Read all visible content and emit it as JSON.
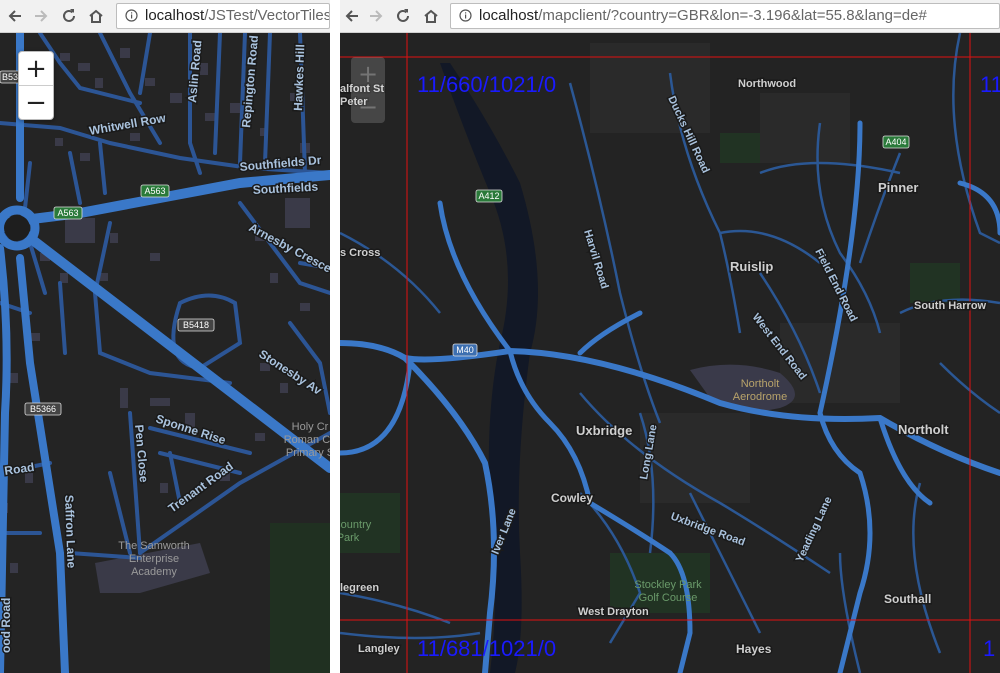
{
  "left_window": {
    "url_host": "localhost",
    "url_path": "/JSTest/VectorTiles/",
    "zoom_in_label": "+",
    "zoom_out_label": "−",
    "labels": {
      "aslin_road": "Aslin Road",
      "repington_road": "Repington Road",
      "hawkes_hill": "Hawkes Hill",
      "whitwell_row": "Whitwell Row",
      "southfields_dr": "Southfields Dr",
      "southfields": "Southfields",
      "arnesby_cresc": "Arnesby Cresce",
      "stonesby_ave": "Stonesby Av",
      "sponne_rise": "Sponne Rise",
      "pen_close": "Pen Close",
      "trenant_road": "Trenant Road",
      "holy_cross_1": "Holy Cr",
      "holy_cross_2": "Roman Ca",
      "holy_cross_3": "Primary S",
      "samworth_1": "The Samworth",
      "samworth_2": "Enterprise",
      "samworth_3": "Academy",
      "saffron_lane": "Saffron Lane",
      "road_left": "Road",
      "ood_road": "ood Road"
    },
    "shields": {
      "a563_1": "A563",
      "a563_2": "A563",
      "b5418": "B5418",
      "b5366": "B5366",
      "b53": "B53"
    }
  },
  "right_window": {
    "url_host": "localhost",
    "url_path": "/mapclient/?country=GBR&lon=-3.196&lat=55.8&lang=de#",
    "zoom_in_label": "+",
    "zoom_out_label": "−",
    "tile_labels": {
      "top_left": "11/660/1021/0",
      "bottom_left": "11/681/1021/0",
      "top_right": "11",
      "bottom_right": "1"
    },
    "labels": {
      "alfont_st": "alfont St",
      "peter": "Peter",
      "northwood": "Northwood",
      "ducks_hill_road": "Ducks Hill Road",
      "pinner": "Pinner",
      "s_cross": "s Cross",
      "harvil_road": "Harvil Road",
      "ruislip": "Ruislip",
      "field_end_road": "Field End Road",
      "south_harrow": "South Harrow",
      "west_end_road": "West End Road",
      "northolt_aerodrome_1": "Northolt",
      "northolt_aerodrome_2": "Aerodrome",
      "uxbridge": "Uxbridge",
      "long_lane": "Long Lane",
      "northolt": "Northolt",
      "cowley": "Cowley",
      "country_1": "Country",
      "country_2": "Park",
      "iver_lane": "Iver Lane",
      "uxbridge_road": "Uxbridge Road",
      "yeading_lane": "Yeading Lane",
      "legreen": "legreen",
      "stockley_1": "Stockley Park",
      "stockley_2": "Golf Course",
      "west_drayton": "West Drayton",
      "southall": "Southall",
      "langley": "Langley",
      "hayes": "Hayes"
    },
    "shields": {
      "a412": "A412",
      "a404": "A404",
      "m40": "M40"
    }
  },
  "colors": {
    "map_bg": "#242424",
    "road_major": "#3a78c8",
    "road_minor": "#2c5595",
    "label_text": "#cfcfcf",
    "tile_label": "#1a1aff",
    "tile_grid": "#e01010"
  }
}
